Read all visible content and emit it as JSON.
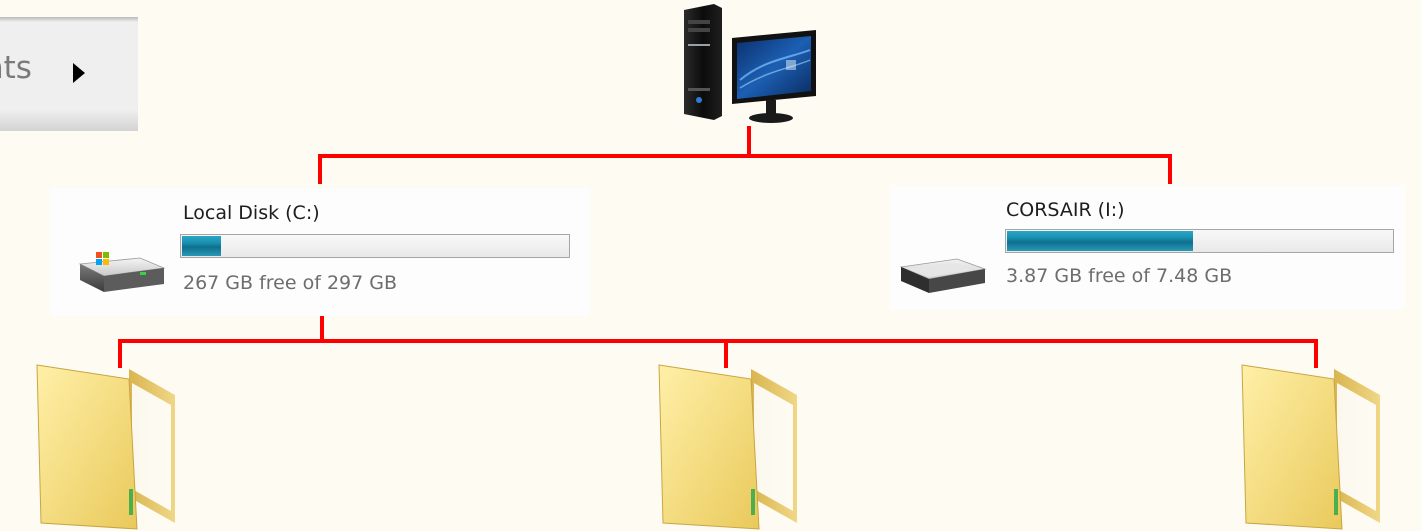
{
  "menu_fragment": {
    "label": "nts"
  },
  "diagram": {
    "connector_color": "#ff0000",
    "root": {
      "icon": "desktop-computer-icon"
    },
    "drives": [
      {
        "name": "Local Disk (C:)",
        "free_text": "267 GB free of 297 GB",
        "free_gb": 267,
        "total_gb": 297,
        "used_fraction": 0.101,
        "icon": "windows-hard-drive-icon"
      },
      {
        "name": "CORSAIR (I:)",
        "free_text": "3.87 GB free of 7.48 GB",
        "free_gb": 3.87,
        "total_gb": 7.48,
        "used_fraction": 0.483,
        "icon": "removable-drive-icon"
      }
    ],
    "folders": [
      {
        "icon": "folder-icon"
      },
      {
        "icon": "folder-icon"
      },
      {
        "icon": "folder-icon"
      }
    ]
  }
}
